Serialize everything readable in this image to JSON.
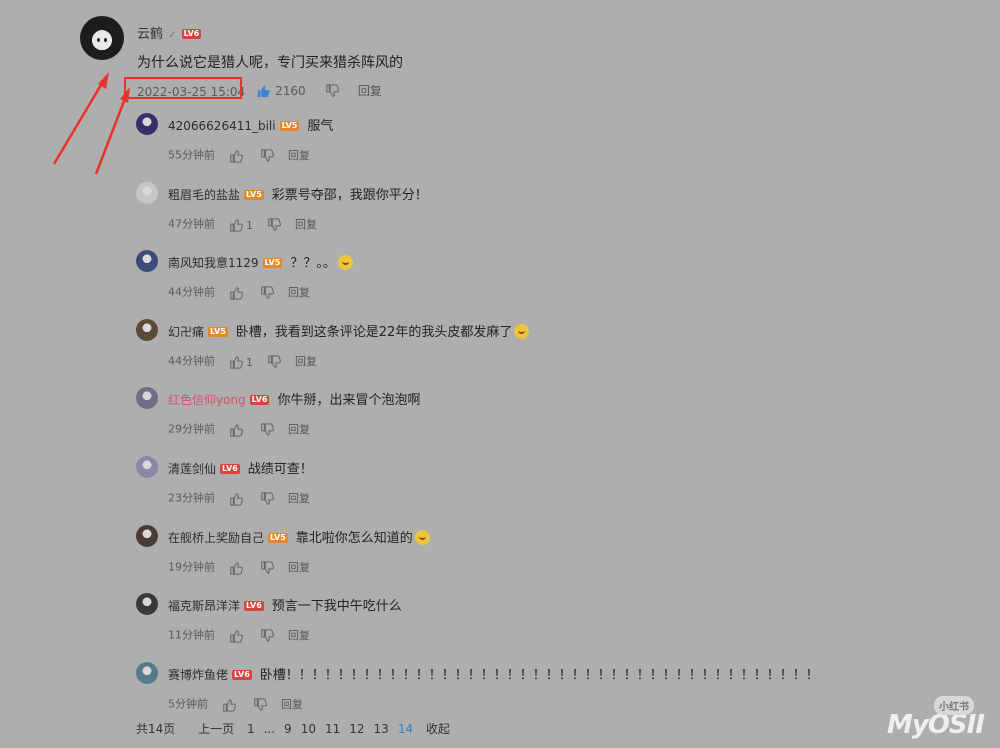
{
  "main_comment": {
    "username": "云鹤",
    "level": "LV6",
    "text": "为什么说它是猎人呢，专门买来猎杀阵风的",
    "timestamp": "2022-03-25 15:04",
    "likes": "2160",
    "reply_label": "回复"
  },
  "replies": [
    {
      "username": "42066626411_bili",
      "level": "LV5",
      "text": "服气",
      "time": "55分钟前",
      "likes": "",
      "reply_label": "回复",
      "avatar_color": "#3b2f6b"
    },
    {
      "username": "粗眉毛的盐盐",
      "level": "LV5",
      "text": "彩票号夺邵，我跟你平分！",
      "time": "47分钟前",
      "likes": "1",
      "reply_label": "回复",
      "avatar_color": "#c7c7c7"
    },
    {
      "username": "南风知我意1129",
      "level": "LV5",
      "text": "？？。。",
      "time": "44分钟前",
      "likes": "",
      "reply_label": "回复",
      "avatar_color": "#3c4c7a",
      "emoji": "laugh-cry-emoji"
    },
    {
      "username": "幻卍痛",
      "level": "LV5",
      "text": "卧槽，我看到这条评论是22年的我头皮都发麻了",
      "time": "44分钟前",
      "likes": "1",
      "reply_label": "回复",
      "avatar_color": "#5b4a37",
      "emoji": "shocked-emoji"
    },
    {
      "username": "红色信仰yong",
      "level": "LV6",
      "text": "你牛掰，出来冒个泡泡啊",
      "time": "29分钟前",
      "likes": "",
      "reply_label": "回复",
      "avatar_color": "#6c6f86",
      "name_color": "#d9506b"
    },
    {
      "username": "清莲剑仙",
      "level": "LV6",
      "text": "战绩可查！",
      "time": "23分钟前",
      "likes": "",
      "reply_label": "回复",
      "avatar_color": "#8e86a6"
    },
    {
      "username": "在舰桥上奖励自己",
      "level": "LV5",
      "text": "靠北啦你怎么知道的",
      "time": "19分钟前",
      "likes": "",
      "reply_label": "回复",
      "avatar_color": "#4b3b33",
      "emoji": "laugh-cry-emoji"
    },
    {
      "username": "福克斯昂洋洋",
      "level": "LV6",
      "text": "预言一下我中午吃什么",
      "time": "11分钟前",
      "likes": "",
      "reply_label": "回复",
      "avatar_color": "#3a3a3a"
    },
    {
      "username": "赛博炸鱼佬",
      "level": "LV6",
      "text": "卧槽！！！！！！！！！！！！！！！！！！！！！！！！！！！！！！！！！！！！！！！！！",
      "time": "5分钟前",
      "likes": "",
      "reply_label": "回复",
      "avatar_color": "#557a8a"
    }
  ],
  "pagination": {
    "total": "共14页",
    "prev": "上一页",
    "pages": [
      "1",
      "...",
      "9",
      "10",
      "11",
      "12",
      "13",
      "14"
    ],
    "current": "14",
    "collapse": "收起"
  },
  "watermark": {
    "brand": "MyOSII",
    "sub": "小红书"
  },
  "colors": {
    "background": "#aeaeae",
    "highlight": "#e8322b",
    "page_active": "#2f7fd8",
    "lv5": "#e4882a",
    "lv6": "#d8453d"
  }
}
